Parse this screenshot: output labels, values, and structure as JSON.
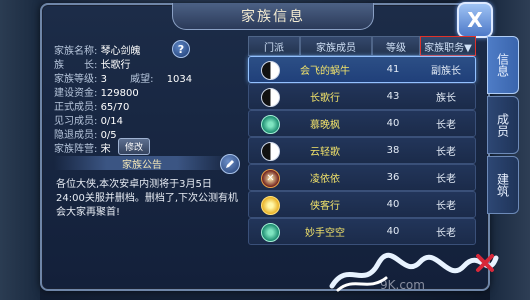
{
  "window": {
    "title": "家族信息",
    "close_label": "X"
  },
  "info": {
    "name_label": "家族名称:",
    "name_value": "琴心剑魄",
    "leader_label": "族　　长:",
    "leader_value": "长歌行",
    "level_label": "家族等级:",
    "level_value": "3",
    "prestige_label": "威望:",
    "prestige_value": "1034",
    "funds_label": "建设资金:",
    "funds_value": "129800",
    "members_label": "正式成员:",
    "members_value": "65/70",
    "trainees_label": "见习成员:",
    "trainees_value": "0/14",
    "hidden_label": "隐退成员:",
    "hidden_value": "0/5",
    "faction_label": "家族阵营:",
    "faction_value": "宋",
    "modify_label": "修改",
    "help_label": "?"
  },
  "notice": {
    "header": "家族公告",
    "text": "各位大侠,本次安卓内测将于3月5日24:00关服并删档。删档了,下次公测有机会大家再聚首!"
  },
  "table": {
    "headers": {
      "sect": "门派",
      "member": "家族成员",
      "level": "等级",
      "role": "家族职务▼"
    },
    "rows": [
      {
        "sect_icon": "yinyang-icon",
        "name": "会飞的蜗牛",
        "level": "41",
        "role": "副族长",
        "selected": true
      },
      {
        "sect_icon": "yinyang-icon",
        "name": "长歌行",
        "level": "43",
        "role": "族长"
      },
      {
        "sect_icon": "tornado-icon",
        "name": "慕晚枫",
        "level": "40",
        "role": "长老"
      },
      {
        "sect_icon": "yinyang-icon",
        "name": "云轻歌",
        "level": "38",
        "role": "长老"
      },
      {
        "sect_icon": "crossed-swords-icon",
        "name": "凌依依",
        "level": "36",
        "role": "长老"
      },
      {
        "sect_icon": "sun-icon",
        "name": "侠客行",
        "level": "40",
        "role": "长老"
      },
      {
        "sect_icon": "tornado-icon",
        "name": "妙手空空",
        "level": "40",
        "role": "长老"
      }
    ]
  },
  "tabs": [
    {
      "label": "信息",
      "active": true
    },
    {
      "label": "成员",
      "active": false
    },
    {
      "label": "建筑",
      "active": false
    }
  ],
  "watermark": "9K.com"
}
